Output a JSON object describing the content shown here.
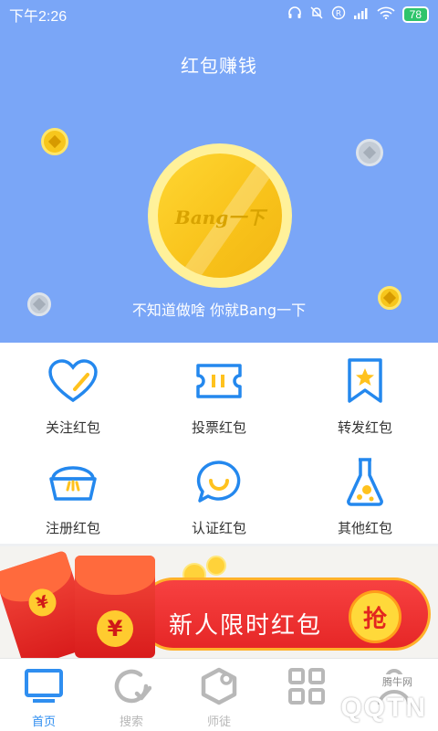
{
  "status_bar": {
    "time": "下午2:26",
    "battery": "78"
  },
  "hero": {
    "title": "红包赚钱",
    "coin_label": "Bang一下",
    "subtitle": "不知道做啥 你就Bang一下"
  },
  "grid": {
    "items": [
      {
        "label": "关注红包",
        "icon": "heart-icon"
      },
      {
        "label": "投票红包",
        "icon": "ticket-icon"
      },
      {
        "label": "转发红包",
        "icon": "bookmark-star-icon"
      },
      {
        "label": "注册红包",
        "icon": "basket-icon"
      },
      {
        "label": "认证红包",
        "icon": "chat-smile-icon"
      },
      {
        "label": "其他红包",
        "icon": "flask-icon"
      }
    ]
  },
  "banner": {
    "text": "新人限时红包",
    "button": "抢",
    "envelope_symbol": "¥"
  },
  "tabbar": {
    "tabs": [
      {
        "label": "首页",
        "active": true,
        "icon": "monitor-icon"
      },
      {
        "label": "搜索",
        "active": false,
        "icon": "refresh-check-icon"
      },
      {
        "label": "师徒",
        "active": false,
        "icon": "cube-icon"
      },
      {
        "label": "",
        "active": false,
        "icon": "grid-icon"
      },
      {
        "label": "",
        "active": false,
        "icon": "user-icon"
      }
    ]
  },
  "watermark": {
    "text": "QQTN",
    "small": "腾牛网"
  },
  "colors": {
    "hero_bg": "#7aa6f7",
    "icon_blue": "#2488ee",
    "icon_yellow": "#ffc21e",
    "active_tab": "#2f8ef0"
  }
}
